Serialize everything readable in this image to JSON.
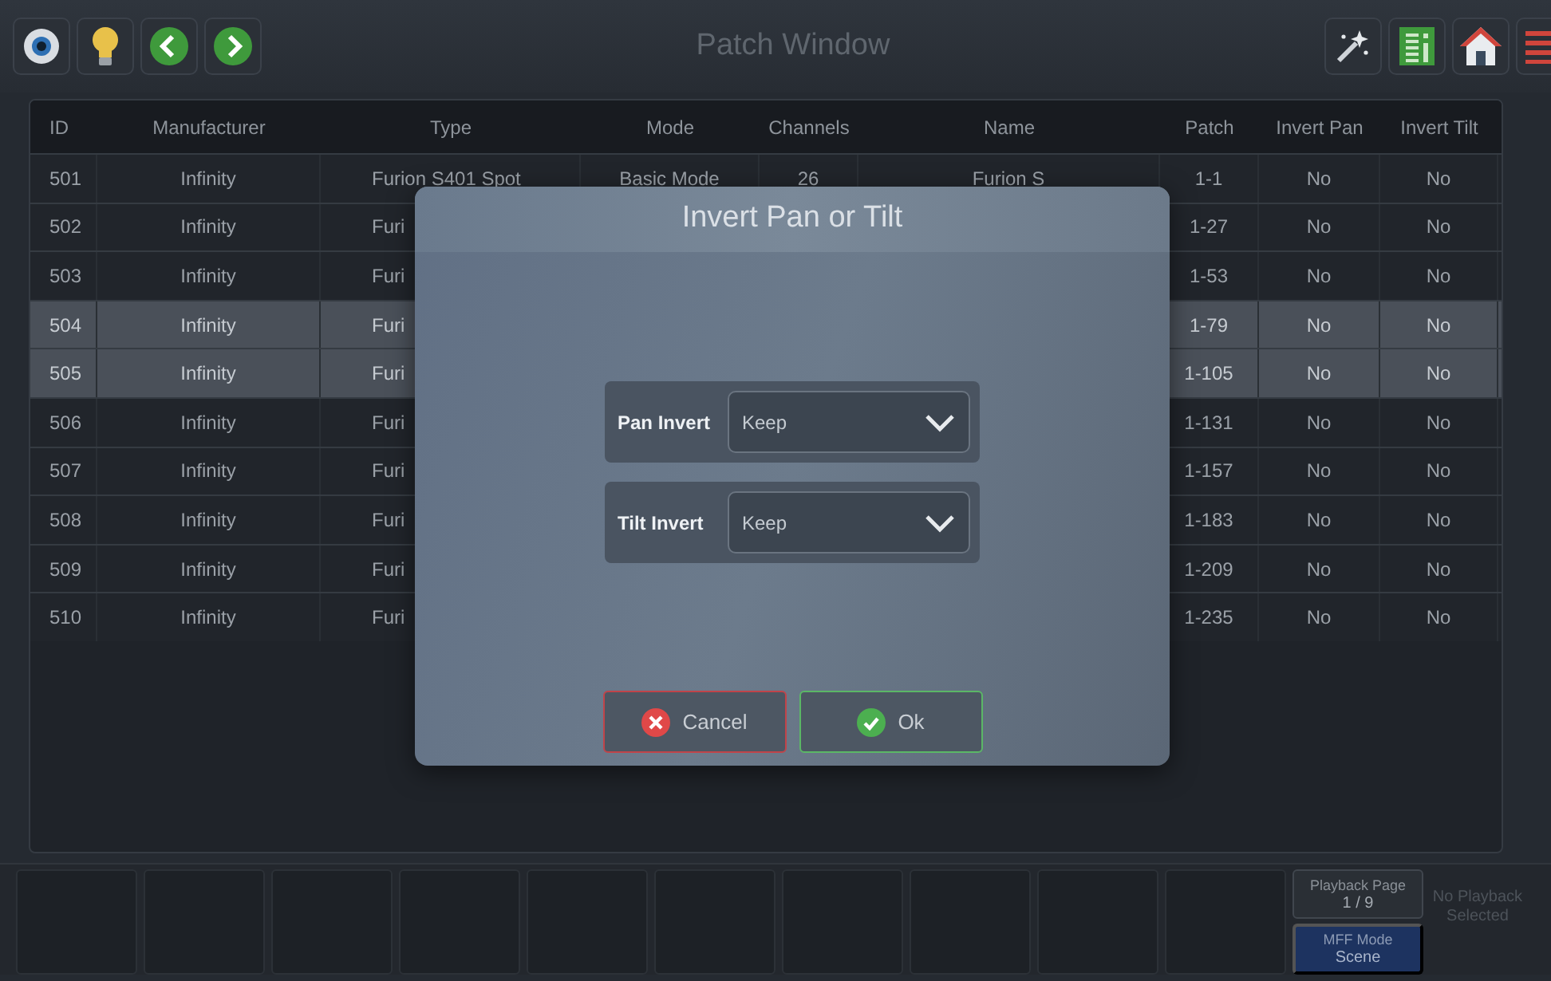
{
  "window": {
    "title": "Patch Window"
  },
  "table": {
    "columns": [
      "ID",
      "Manufacturer",
      "Type",
      "Mode",
      "Channels",
      "Name",
      "Patch",
      "Invert Pan",
      "Invert Tilt"
    ],
    "rows": [
      {
        "selected": false,
        "cells": [
          "501",
          "Infinity",
          "Furion S401 Spot",
          "Basic Mode",
          "26",
          "Furion S",
          "1-1",
          "No",
          "No"
        ]
      },
      {
        "selected": false,
        "cells": [
          "502",
          "Infinity",
          "Furi",
          null,
          null,
          null,
          "1-27",
          "No",
          "No"
        ]
      },
      {
        "selected": false,
        "cells": [
          "503",
          "Infinity",
          "Furi",
          null,
          null,
          null,
          "1-53",
          "No",
          "No"
        ]
      },
      {
        "selected": true,
        "cells": [
          "504",
          "Infinity",
          "Furi",
          null,
          null,
          null,
          "1-79",
          "No",
          "No"
        ]
      },
      {
        "selected": true,
        "cells": [
          "505",
          "Infinity",
          "Furi",
          null,
          null,
          null,
          "1-105",
          "No",
          "No"
        ]
      },
      {
        "selected": false,
        "cells": [
          "506",
          "Infinity",
          "Furi",
          null,
          null,
          null,
          "1-131",
          "No",
          "No"
        ]
      },
      {
        "selected": false,
        "cells": [
          "507",
          "Infinity",
          "Furi",
          null,
          null,
          null,
          "1-157",
          "No",
          "No"
        ]
      },
      {
        "selected": false,
        "cells": [
          "508",
          "Infinity",
          "Furi",
          null,
          null,
          null,
          "1-183",
          "No",
          "No"
        ]
      },
      {
        "selected": false,
        "cells": [
          "509",
          "Infinity",
          "Furi",
          null,
          null,
          null,
          "1-209",
          "No",
          "No"
        ]
      },
      {
        "selected": false,
        "cells": [
          "510",
          "Infinity",
          "Furi",
          null,
          null,
          null,
          "1-235",
          "No",
          "No"
        ]
      }
    ]
  },
  "dialog": {
    "title": "Invert Pan or Tilt",
    "fields": [
      {
        "label": "Pan Invert",
        "value": "Keep"
      },
      {
        "label": "Tilt Invert",
        "value": "Keep"
      }
    ],
    "buttons": [
      {
        "kind": "cancel",
        "label": "Cancel"
      },
      {
        "kind": "ok",
        "label": "Ok"
      }
    ]
  },
  "bottom_bar": {
    "playback_page": {
      "label": "Playback Page",
      "value": "1 / 9"
    },
    "mff_mode": {
      "label": "MFF Mode",
      "value": "Scene"
    },
    "status": "No Playback Selected"
  }
}
